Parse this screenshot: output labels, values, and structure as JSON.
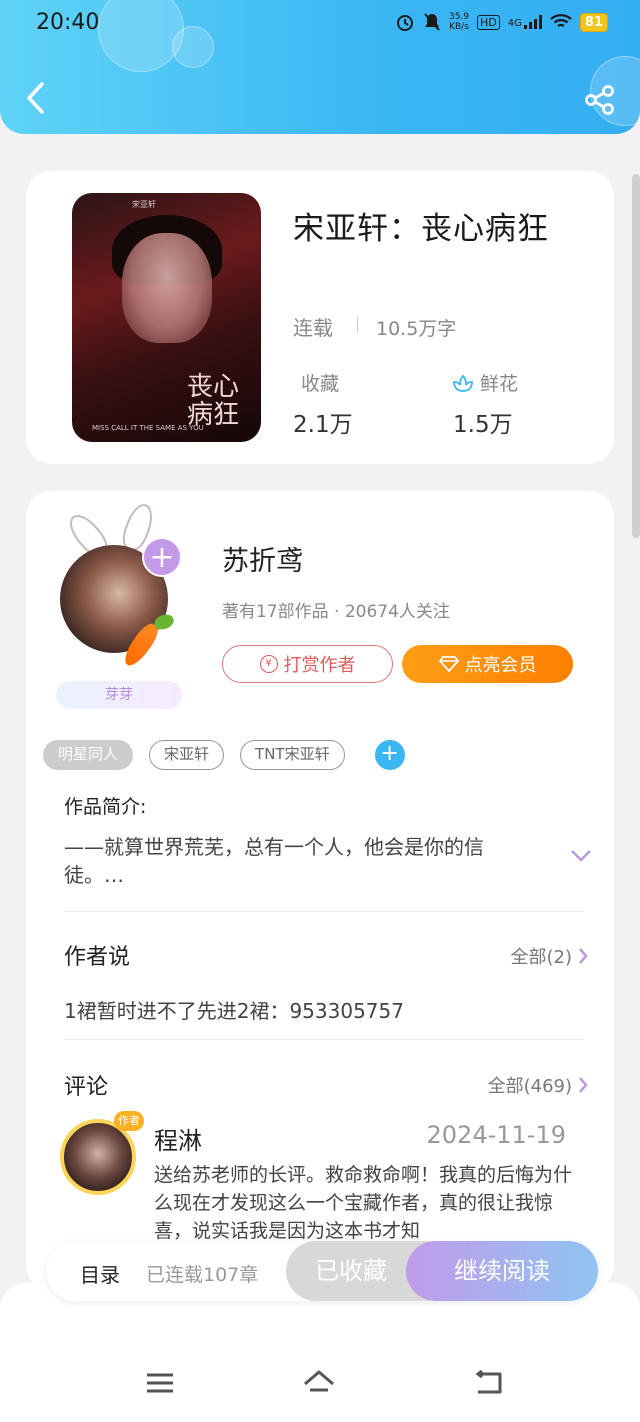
{
  "status_bar": {
    "time": "20:40",
    "net_speed_value": "35.9",
    "net_speed_unit": "KB/s",
    "hd": "HD",
    "signal": "4G",
    "battery": "81"
  },
  "book": {
    "title": "宋亚轩：丧心病狂",
    "status": "连载",
    "word_count": "10.5万字",
    "favorites_label": "收藏",
    "favorites_value": "2.1万",
    "flowers_label": "鲜花",
    "flowers_value": "1.5万",
    "cover_title": "丧心病狂",
    "cover_top_text": "宋亚轩",
    "cover_bottom_text": "MISS CALL IT THE SAME AS YOU"
  },
  "author": {
    "name": "苏折鸢",
    "meta": "著有17部作品 · 20674人关注",
    "tip_button": "打赏作者",
    "vip_button": "点亮会员",
    "level_badge": "芽芽"
  },
  "tags": [
    "明星同人",
    "宋亚轩",
    "TNT宋亚轩"
  ],
  "intro": {
    "title": "作品简介:",
    "text": "——就算世界荒芜，总有一个人，他会是你的信徒。…"
  },
  "author_says": {
    "title": "作者说",
    "more": "全部(2)",
    "text": "1裙暂时进不了先进2裙：953305757"
  },
  "comments": {
    "title": "评论",
    "more": "全部(469)",
    "items": [
      {
        "name": "程淋",
        "badge": "作者",
        "date": "2024-11-19",
        "text": "送给苏老师的长评。救命救命啊！我真的后悔为什么现在才发现这么一个宝藏作者，真的很让我惊喜，说实话我是因为这本书才知"
      }
    ]
  },
  "bottom_bar": {
    "toc": "目录",
    "chapter_count": "已连载107章",
    "collected": "已收藏",
    "continue_reading": "继续阅读"
  },
  "colors": {
    "header_accent": "#3ab6f3",
    "vip_orange": "#ff8c0a",
    "tip_red": "#e05c5c",
    "purple_accent": "#c39ae8"
  }
}
